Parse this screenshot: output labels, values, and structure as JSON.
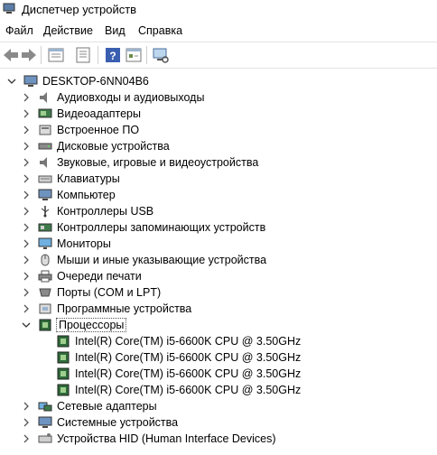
{
  "window": {
    "title": "Диспетчер устройств"
  },
  "menu": [
    "Файл",
    "Действие",
    "Вид",
    "Справка"
  ],
  "toolbar": [
    "back-icon",
    "forward-icon",
    "properties-icon",
    "update-driver-icon",
    "help-icon",
    "show-hidden-icon",
    "scan-icon"
  ],
  "tree": {
    "root": "DESKTOP-6NN04B6",
    "categories": [
      "Аудиовходы и аудиовыходы",
      "Видеоадаптеры",
      "Встроенное ПО",
      "Дисковые устройства",
      "Звуковые, игровые и видеоустройства",
      "Клавиатуры",
      "Компьютер",
      "Контроллеры USB",
      "Контроллеры запоминающих устройств",
      "Мониторы",
      "Мыши и иные указывающие устройства",
      "Очереди печати",
      "Порты (COM и LPT)",
      "Программные устройства",
      "Процессоры"
    ],
    "processors": [
      "Intel(R) Core(TM) i5-6600K CPU @ 3.50GHz",
      "Intel(R) Core(TM) i5-6600K CPU @ 3.50GHz",
      "Intel(R) Core(TM) i5-6600K CPU @ 3.50GHz",
      "Intel(R) Core(TM) i5-6600K CPU @ 3.50GHz"
    ],
    "after": [
      "Сетевые адаптеры",
      "Системные устройства",
      "Устройства HID (Human Interface Devices)"
    ]
  }
}
